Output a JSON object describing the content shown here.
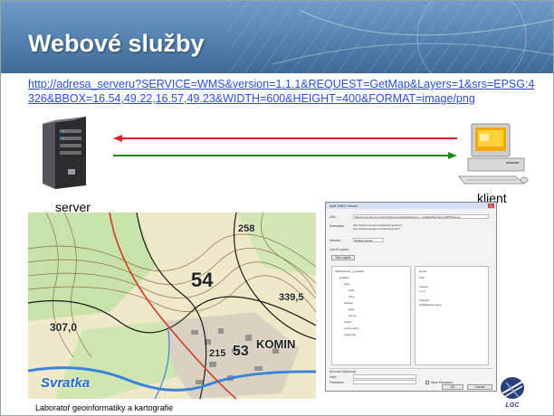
{
  "title": "Webové služby",
  "request_url": "http://adresa_serveru?SERVICE=WMS&version=1.1.1&REQUEST=GetMap&Layers=1&srs=EPSG:4326&BBOX=16.54,49.22,16.57,49.23&WIDTH=600&HEIGHT=400&FORMAT=image/png",
  "server_label": "server",
  "client_label": "klient",
  "arrow_colors": {
    "request": "#e02020",
    "response": "#1a8a1a"
  },
  "map_labels": [
    "258",
    "54",
    "339,5",
    "KOMIN",
    "307,0",
    "Svratka",
    "215",
    "53"
  ],
  "dialog": {
    "title": "Add WMS Server",
    "close": "x",
    "url_label": "URL:",
    "url_value": "http://geoportal.gov.cz/ArcGIS/services/CENIA/cenia_t_podklad/MapServer/WMSServer",
    "examples_label": "Examples:",
    "example_1": "http://www.mywms.com/geoserver/wms?",
    "example_2": "http://www.example.com/service/wms?",
    "version_label": "Version:",
    "version_value": "Default version",
    "layers_label": "List of Layers:",
    "get_layers_button": "Get Layers",
    "tree": [
      "CENIA/cenia_t_podklad",
      "podklad",
      "body",
      "sídla",
      "obce",
      "hranice",
      "kraje",
      "okresy",
      "silnice",
      "vodní plochy",
      "vodní toky"
    ],
    "props": [
      "Name:",
      "Title:",
      "Version:",
      "1.1.1",
      "Abstract:",
      "Podkladová mapa"
    ],
    "account_label": "Account (Optional)",
    "user_label": "User:",
    "password_label": "Password:",
    "save_password_label": "Save Password",
    "ok_button": "OK",
    "cancel_button": "Cancel"
  },
  "logo_text": "LGC",
  "footer": "Laboratoř geoinformatiky a kartografie"
}
